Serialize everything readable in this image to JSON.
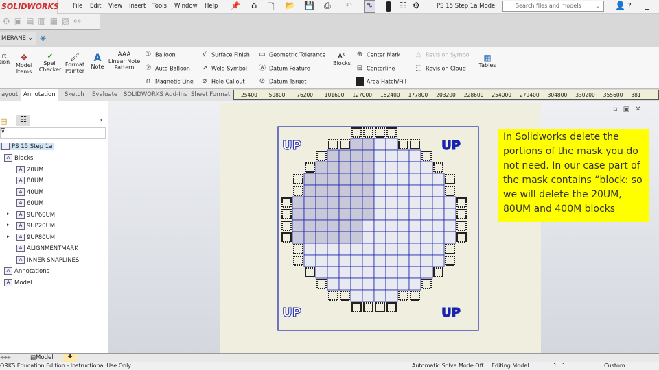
{
  "app": {
    "logo": "SOLIDWORKS",
    "document_title": "PS 15 Step 1a  Model",
    "search_placeholder": "Search files and models",
    "accent": "#d42a2a"
  },
  "menu": [
    "File",
    "Edit",
    "View",
    "Insert",
    "Tools",
    "Window",
    "Help"
  ],
  "layer_combo": "MERANE",
  "ribbon": {
    "large": [
      "rt\nsion",
      "Model\nItems",
      "Spell\nChecker",
      "Format\nPainter",
      "Note",
      "Linear Note\nPattern",
      "Blocks",
      "Tables"
    ],
    "small": [
      [
        "Balloon",
        "Auto Balloon",
        "Magnetic Line"
      ],
      [
        "Surface Finish",
        "Weld Symbol",
        "Hole Callout"
      ],
      [
        "Geometric Tolerance",
        "Datum Feature",
        "Datum Target"
      ],
      [
        "Center Mark",
        "Centerline",
        "Area Hatch/Fill"
      ],
      [
        "Revision Symbol",
        "Revision Cloud"
      ]
    ]
  },
  "tabs": [
    "ayout",
    "Annotation",
    "Sketch",
    "Evaluate",
    "SOLIDWORKS Add-Ins",
    "Sheet Format"
  ],
  "active_tab": "Annotation",
  "ruler": [
    "25400",
    "50800",
    "76200",
    "101600",
    "127000",
    "152400",
    "177800",
    "203200",
    "228600",
    "254000",
    "279400",
    "304800",
    "330200",
    "355600",
    "381"
  ],
  "tree": {
    "root": "PS 15 Step 1a",
    "items": [
      {
        "label": "Blocks",
        "level": 1
      },
      {
        "label": "20UM",
        "level": 2
      },
      {
        "label": "80UM",
        "level": 2
      },
      {
        "label": "40UM",
        "level": 2
      },
      {
        "label": "60UM",
        "level": 2
      },
      {
        "label": "9UP60UM",
        "level": 2,
        "expandable": true
      },
      {
        "label": "9UP20UM",
        "level": 2,
        "expandable": true
      },
      {
        "label": "9UP80UM",
        "level": 2,
        "expandable": true
      },
      {
        "label": "ALIGNMENTMARK",
        "level": 2
      },
      {
        "label": "INNER SNAPLINES",
        "level": 2
      },
      {
        "label": "Annotations",
        "level": 1
      },
      {
        "label": "Model",
        "level": 1
      }
    ]
  },
  "drawing": {
    "corner_labels": [
      "UP",
      "UP",
      "UP",
      "UP"
    ],
    "line_color": "#1a22b0"
  },
  "note": "In Solidworks delete the portions of the mask you do not need. In our case part of the mask contains “block: so we will delete the 20UM, 80UM and 400M blocks",
  "bottom_tabs": [
    "Model"
  ],
  "status": {
    "edition": "ORKS Education Edition - Instructional Use Only",
    "solve_mode": "Automatic Solve Mode Off",
    "editing": "Editing Model",
    "scale": "1 : 1",
    "units": "Custom"
  }
}
